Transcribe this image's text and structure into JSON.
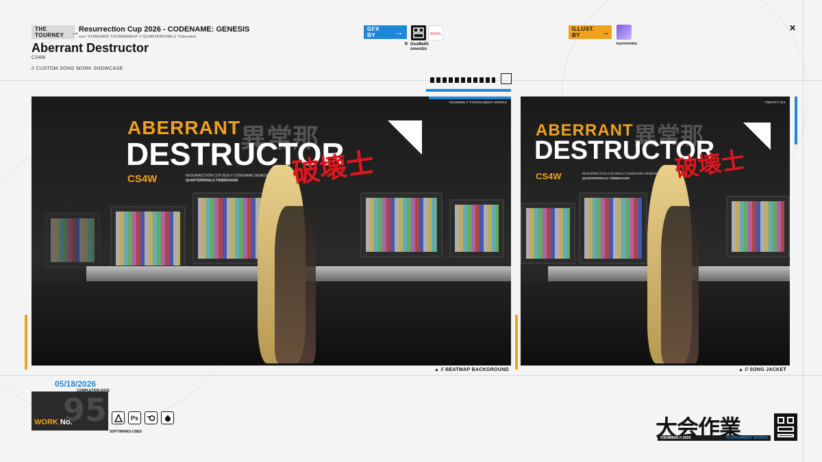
{
  "header": {
    "tourney_tag": "THE\nTOURNEY",
    "tourney_title": "Resurrection Cup 2026 - CODENAME: GENESIS",
    "tourney_sub": "osu! STANDARD TOURNAMENT // QUARTERFINALS Tiebreaker",
    "page_title": "Aberrant Destructor",
    "artist": "CS4W",
    "showcase": "// CUSTOM SONG WORK SHOWCASE"
  },
  "credits": {
    "gfx_label": "GFX\nBY",
    "gfx_names": [
      "OsuMe65",
      "smordzc"
    ],
    "illust_label": "ILLUST.\nBY",
    "illust_name": "kyermoniac"
  },
  "panels": {
    "left_caption": "▲ // BEATMAP BACKGROUND",
    "right_caption": "▲ // SONG JACKET",
    "left_frame_label": "OSUME65 // TOURNAMENT WORKS",
    "right_frame_label": "TWENTY SIX"
  },
  "artwork": {
    "title_top": "ABERRANT",
    "title_main": "DESTRUCTOR",
    "kanji_red": "破壊士",
    "kanji_grey": "異常那",
    "cs4w": "CS4W",
    "sub_line1": "RESURRECTION CUP 2026 // CODENAME GENESIS",
    "sub_line2": "QUARTERFINALS TIEBREAKER"
  },
  "work": {
    "date": "05/18/2026",
    "date_label": "COMPLETION DATE",
    "label": "WORK",
    "label_no": "No.",
    "number": "95",
    "software_label": "SOFTWARES USED",
    "software_icons": [
      "affinity-icon",
      "photoshop-icon",
      "blender-icon",
      "krita-icon"
    ],
    "ps_text": "Ps"
  },
  "brand": {
    "kanji": "大会作業",
    "left": "OSUME65 // 2026",
    "right": "TOURNAMENT WORKS"
  },
  "colors": {
    "accent_blue": "#1e88d8",
    "accent_orange": "#f0a21c",
    "kanji_red": "#e0161e"
  }
}
